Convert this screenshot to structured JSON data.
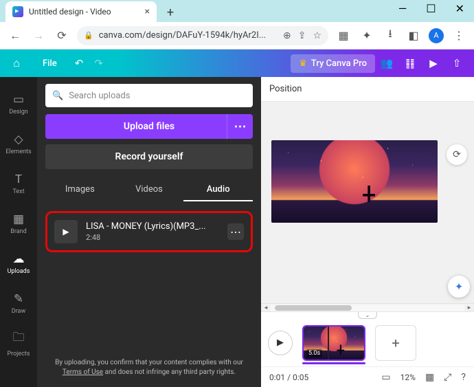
{
  "browser": {
    "tab_title": "Untitled design - Video",
    "url": "canva.com/design/DAFuY-1594k/hyAr2I...",
    "avatar_initial": "A"
  },
  "app_header": {
    "file_label": "File",
    "try_label": "Try Canva Pro"
  },
  "rail": {
    "items": [
      {
        "label": "Design",
        "icon": "▭"
      },
      {
        "label": "Elements",
        "icon": "◇"
      },
      {
        "label": "Text",
        "icon": "T"
      },
      {
        "label": "Brand",
        "icon": "▦"
      },
      {
        "label": "Uploads",
        "icon": "☁"
      },
      {
        "label": "Draw",
        "icon": "✎"
      },
      {
        "label": "Projects",
        "icon": "🗀"
      }
    ],
    "active_index": 4
  },
  "panel": {
    "search_placeholder": "Search uploads",
    "upload_label": "Upload files",
    "record_label": "Record yourself",
    "tabs": [
      "Images",
      "Videos",
      "Audio"
    ],
    "active_tab": 2,
    "audio": {
      "title": "LISA - MONEY (Lyrics)(MP3_...",
      "duration": "2:48"
    },
    "disclaimer_pre": "By uploading, you confirm that your content complies with our ",
    "disclaimer_link": "Terms of Use",
    "disclaimer_post": " and does not infringe any third party rights."
  },
  "canvas": {
    "position_label": "Position"
  },
  "timeline": {
    "clip_duration": "5.0s",
    "time": "0:01 / 0:05",
    "zoom": "12%"
  }
}
